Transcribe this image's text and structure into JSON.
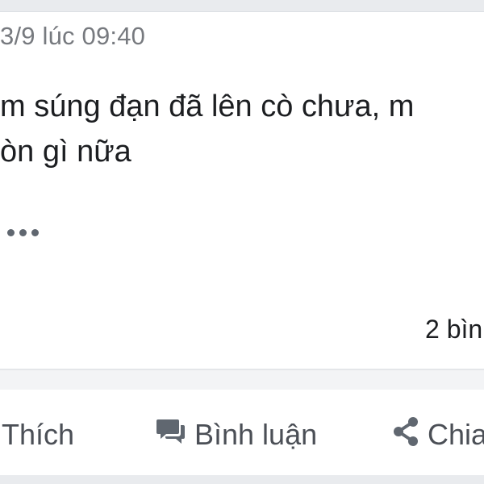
{
  "post": {
    "timestamp": "3/9 lúc 09:40",
    "text_line1": "m súng đạn đã lên cò chưa, m",
    "text_line2": "òn gì nữa"
  },
  "stats": {
    "comments": "2 bìn"
  },
  "actions": {
    "like_label": "Thích",
    "comment_label": "Bình luận",
    "share_label": "Chia"
  },
  "icons": {
    "more": "more-dots-icon",
    "comment": "comment-bubbles-icon",
    "share": "share-icon"
  },
  "colors": {
    "text": "#1c1e21",
    "secondary_text": "#777a7f",
    "action_text": "#4b4f56",
    "background_gray": "#e9ebee"
  }
}
